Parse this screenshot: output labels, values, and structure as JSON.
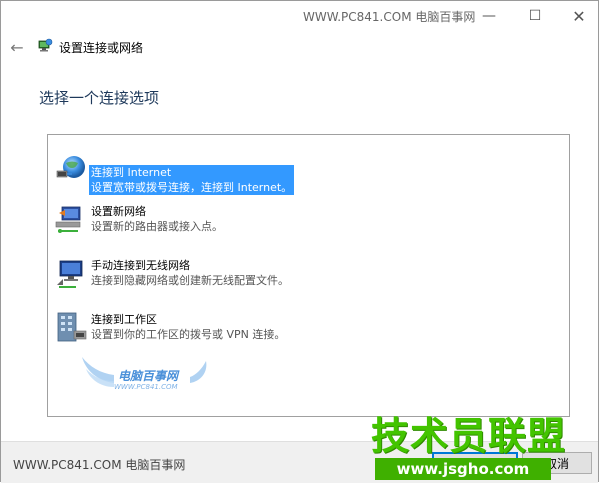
{
  "titlebar": {
    "watermark": "WWW.PC841.COM 电脑百事网",
    "minimize_glyph": "—",
    "maximize_glyph": "☐",
    "close_glyph": "✕"
  },
  "header": {
    "back_glyph": "←",
    "title": "设置连接或网络",
    "icon": "network-setup-icon"
  },
  "page_title": "选择一个连接选项",
  "options": [
    {
      "title": "连接到 Internet",
      "desc": "设置宽带或拨号连接，连接到 Internet。",
      "icon": "globe-icon",
      "selected": true
    },
    {
      "title": "设置新网络",
      "desc": "设置新的路由器或接入点。",
      "icon": "router-icon",
      "selected": false
    },
    {
      "title": "手动连接到无线网络",
      "desc": "连接到隐藏网络或创建新无线配置文件。",
      "icon": "wireless-monitor-icon",
      "selected": false
    },
    {
      "title": "连接到工作区",
      "desc": "设置到你的工作区的拨号或 VPN 连接。",
      "icon": "workplace-icon",
      "selected": false
    }
  ],
  "list_watermark": {
    "name": "电脑百事网",
    "url": "WWW.PC841.COM"
  },
  "footer": {
    "watermark": "WWW.PC841.COM 电脑百事网",
    "next_label": "",
    "cancel_label": "取消"
  },
  "brand": {
    "name": "技术员联盟",
    "url": "www.jsgho.com"
  },
  "colors": {
    "selection": "#3399ff",
    "page_title": "#1e395b",
    "brand_green": "#43c400",
    "footer_bg": "#f0f0f0"
  }
}
